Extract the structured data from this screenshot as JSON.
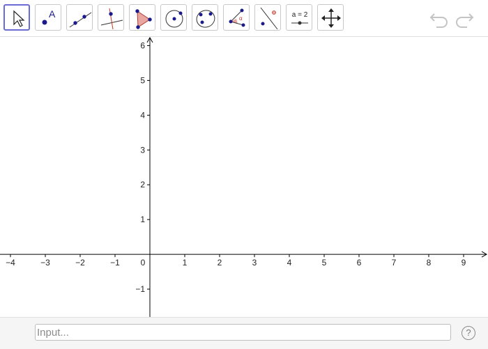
{
  "toolbar": {
    "tools": [
      {
        "name": "move-tool-button",
        "icon": "move-arrow-icon",
        "selected": true
      },
      {
        "name": "point-tool-button",
        "icon": "point-icon",
        "selected": false
      },
      {
        "name": "line-tool-button",
        "icon": "line-icon",
        "selected": false
      },
      {
        "name": "perpendicular-line-tool-button",
        "icon": "perpendicular-line-icon",
        "selected": false
      },
      {
        "name": "polygon-tool-button",
        "icon": "polygon-icon",
        "selected": false
      },
      {
        "name": "circle-tool-button",
        "icon": "circle-center-point-icon",
        "selected": false
      },
      {
        "name": "ellipse-tool-button",
        "icon": "ellipse-icon",
        "selected": false
      },
      {
        "name": "angle-tool-button",
        "icon": "angle-icon",
        "selected": false
      },
      {
        "name": "reflect-tool-button",
        "icon": "reflect-about-line-icon",
        "selected": false
      },
      {
        "name": "slider-tool-button",
        "icon": "slider-icon",
        "selected": false
      },
      {
        "name": "move-graphics-view-button",
        "icon": "move-view-cross-arrows-icon",
        "selected": false
      }
    ],
    "slider_icon_text": "a = 2",
    "point_icon_text": "A",
    "angle_icon_text": "α",
    "undo_icon": "undo-icon",
    "redo_icon": "redo-icon"
  },
  "graphics_view": {
    "x_range": [
      -4.3,
      9.7
    ],
    "y_range": [
      -1.8,
      6.25
    ],
    "x_ticks": [
      "−4",
      "−3",
      "−2",
      "−1",
      "0",
      "1",
      "2",
      "3",
      "4",
      "5",
      "6",
      "7",
      "8",
      "9"
    ],
    "x_tick_values": [
      -4,
      -3,
      -2,
      -1,
      0,
      1,
      2,
      3,
      4,
      5,
      6,
      7,
      8,
      9
    ],
    "y_ticks": [
      "−1",
      "1",
      "2",
      "3",
      "4",
      "5",
      "6"
    ],
    "y_tick_values": [
      -1,
      1,
      2,
      3,
      4,
      5,
      6
    ],
    "axis_color": "#000000"
  },
  "input_bar": {
    "placeholder": "Input...",
    "value": "",
    "help_label": "?"
  },
  "colors": {
    "selected_border": "#6b6bd6",
    "point_blue": "#1a1a8c",
    "polygon_fill": "#e9a6a0",
    "accent_red": "#c0392b"
  }
}
